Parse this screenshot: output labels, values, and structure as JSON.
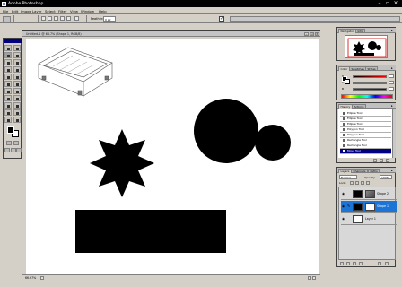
{
  "window": {
    "title": "Adobe Photoshop"
  },
  "menu": [
    "File",
    "Edit",
    "Image",
    "Layer",
    "Select",
    "Filter",
    "View",
    "Window",
    "Help"
  ],
  "options": {
    "feather_label": "Feather:",
    "feather_value": "0 px"
  },
  "document": {
    "title": "Untitled-1 @ 66.7% (Shape 1, RGB/8)",
    "status": "66.67%"
  },
  "navigator_panel": {
    "tabs": [
      "Navigator",
      "Info"
    ]
  },
  "color_panel": {
    "tabs": [
      "Color",
      "Swatches",
      "Styles"
    ],
    "channels": [
      "R",
      "G",
      "B"
    ]
  },
  "history_panel": {
    "tabs": [
      "History",
      "Actions"
    ],
    "items": [
      "Ellipse Tool",
      "Ellipse Tool",
      "Ellipse Tool",
      "Polygon Tool",
      "Polygon Tool",
      "Rectangle Tool",
      "Rectangle Tool",
      "Move Tool"
    ]
  },
  "layers_panel": {
    "tabs": [
      "Layers",
      "Channels",
      "Paths"
    ],
    "blend_mode": "Normal",
    "opacity_label": "Opacity:",
    "opacity": "100%",
    "lock_label": "Lock:",
    "layers": [
      {
        "name": "Shape 2",
        "visible": true,
        "active": false
      },
      {
        "name": "Shape 1",
        "visible": true,
        "active": true
      },
      {
        "name": "Layer 1",
        "visible": true,
        "active": false
      }
    ]
  },
  "colors": {
    "title_bar": "#000000",
    "workspace": "#d4d0c8",
    "active_layer": "#1c74d6",
    "history_selection": "#000080",
    "shapes": "#000000"
  }
}
